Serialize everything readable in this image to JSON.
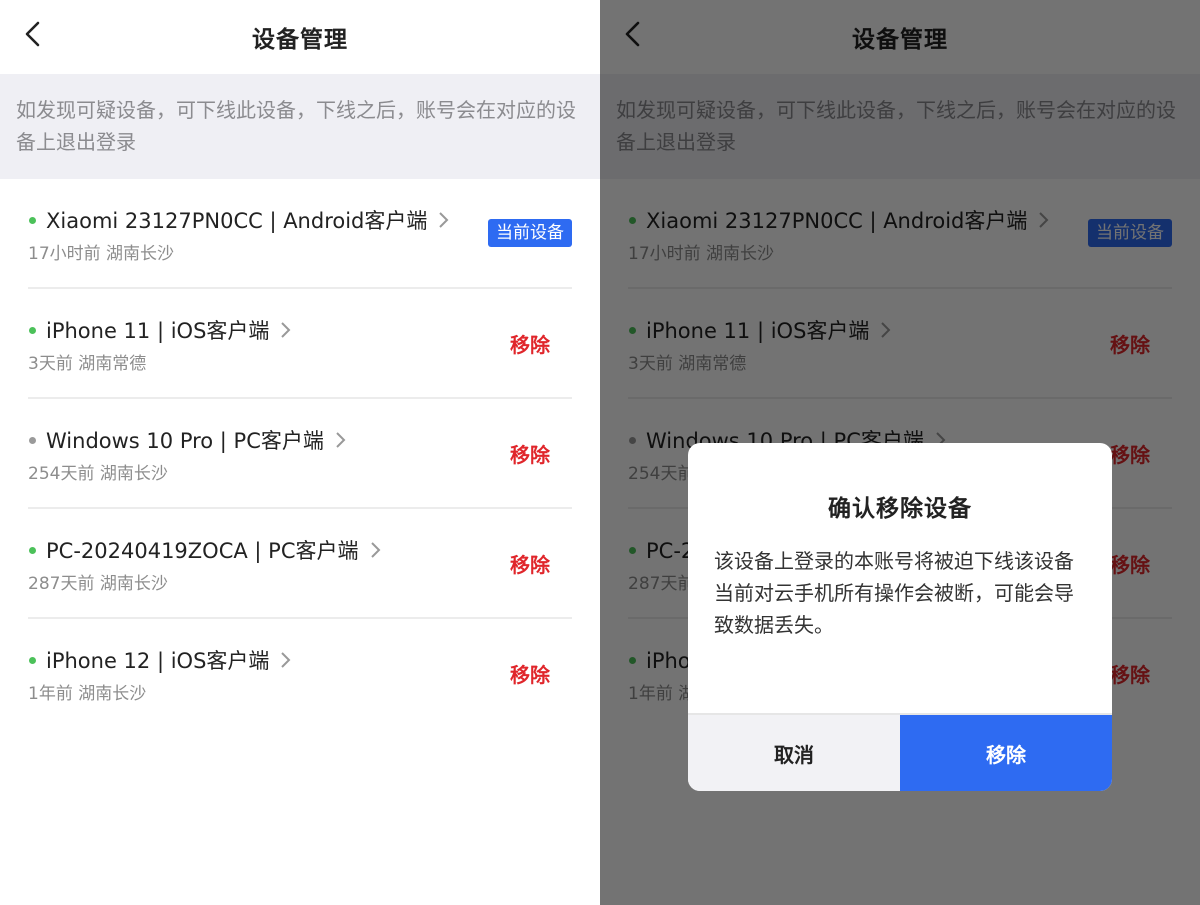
{
  "header": {
    "title": "设备管理"
  },
  "notice": "如发现可疑设备，可下线此设备，下线之后，账号会在对应的设备上退出登录",
  "devices": [
    {
      "name": "Xiaomi 23127PN0CC | Android客户端",
      "meta": "17小时前  湖南长沙",
      "badge": "当前设备",
      "dot": "green"
    },
    {
      "name": "iPhone 11 | iOS客户端",
      "meta": "3天前  湖南常德",
      "action": "移除",
      "dot": "green"
    },
    {
      "name": "Windows 10 Pro | PC客户端",
      "meta": "254天前  湖南长沙",
      "action": "移除",
      "dot": "gray"
    },
    {
      "name": "PC-20240419ZOCA | PC客户端",
      "meta": "287天前  湖南长沙",
      "action": "移除",
      "dot": "green"
    },
    {
      "name": "iPhone 12 | iOS客户端",
      "meta": "1年前  湖南长沙",
      "action": "移除",
      "dot": "green"
    }
  ],
  "dialog": {
    "title": "确认移除设备",
    "body": "该设备上登录的本账号将被迫下线该设备当前对云手机所有操作会被断，可能会导致数据丢失。",
    "cancel_label": "取消",
    "confirm_label": "移除"
  },
  "colors": {
    "accent": "#2e6bf2",
    "danger": "#e0262b",
    "online": "#4cc15a",
    "offline": "#9a9a9a"
  }
}
